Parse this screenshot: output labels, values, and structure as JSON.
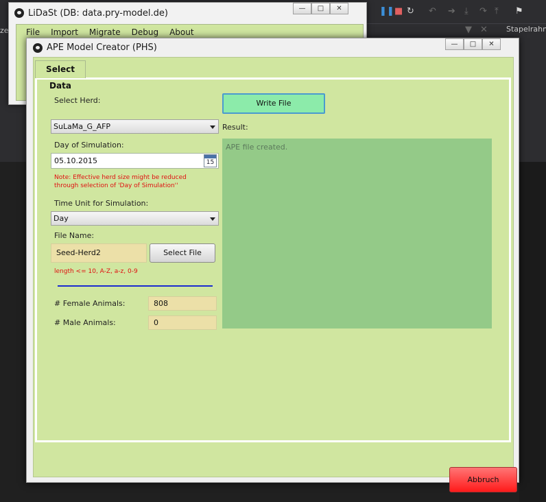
{
  "background_window": {
    "title": "LiDaSt (DB: data.pry-model.de)",
    "menu": [
      "File",
      "Import",
      "Migrate",
      "Debug",
      "About"
    ],
    "controls": {
      "minimize": "—",
      "maximize": "□",
      "close": "✕"
    }
  },
  "ide": {
    "side_text": "ze",
    "toolbar_right_text": "Stapelrahm"
  },
  "dialog": {
    "title": "APE Model Creator (PHS)",
    "controls": {
      "minimize": "—",
      "maximize": "□",
      "close": "✕"
    },
    "tab_label": "Select Data",
    "select_herd_label": "Select Herd:",
    "herd_value": "SuLaMa_G_AFP",
    "day_label": "Day of Simulation:",
    "day_value": "05.10.2015",
    "calendar_day": "15",
    "note": "Note: Effective herd size might be reduced through selection of 'Day of Simulation''",
    "time_unit_label": "Time Unit for Simulation:",
    "time_unit_value": "Day",
    "file_name_label": "File Name:",
    "file_name_value": "Seed-Herd2",
    "select_file_button": "Select File",
    "length_hint": "length <= 10, A-Z, a-z, 0-9",
    "progress": 1.0,
    "female_label": "# Female Animals:",
    "female_value": "808",
    "male_label": "# Male Animals:",
    "male_value": "0",
    "write_file_button": "Write File",
    "result_label": "Result:",
    "result_text": "APE file created.",
    "cancel_button": "Abbruch"
  },
  "colors": {
    "panel_green": "#d0e6a0",
    "result_green": "#94ca88",
    "input_yellow": "#ece0a8",
    "note_red": "#e01010",
    "cancel_red": "#ff2a2a",
    "write_button": "#8cebaa"
  }
}
